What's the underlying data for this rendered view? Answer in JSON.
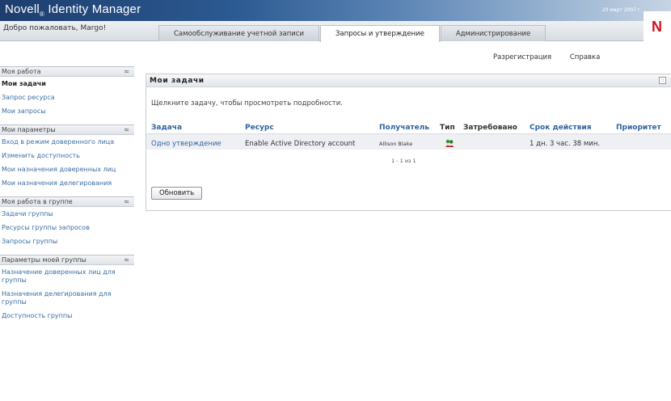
{
  "header": {
    "brand": "Novell",
    "brand_mark": "®",
    "brand_product": " Identity Manager",
    "date": "20 март 2007 г.",
    "logo_letter": "N",
    "welcome": "Добро пожаловать, Margo!"
  },
  "tabs": [
    {
      "label": "Самообслуживание учетной записи",
      "active": false
    },
    {
      "label": "Запросы и утверждение",
      "active": true
    },
    {
      "label": "Администрирование",
      "active": false
    }
  ],
  "toplinks": {
    "logout": "Разрегистрация",
    "help": "Справка"
  },
  "sidebar": {
    "sections": [
      {
        "title": "Моя работа",
        "items": [
          "Мои задачи",
          "Запрос ресурса",
          "Мои запросы"
        ]
      },
      {
        "title": "Мои параметры",
        "items": [
          "Вход в режим доверенного лица",
          "Изменить доступность",
          "Мои назначения доверенных лиц",
          "Мои назначения делегирования"
        ]
      },
      {
        "title": "Моя работа в группе",
        "items": [
          "Задачи группы",
          "Ресурсы группы запросов",
          "Запросы группы"
        ]
      },
      {
        "title": "Параметры моей группы",
        "items": [
          "Назначение доверенных лиц для группы",
          "Назначения делегирования для группы",
          "Доступность группы"
        ]
      }
    ],
    "collapse_glyph": "≈"
  },
  "panel": {
    "title": "Мои задачи",
    "hint": "Щелкните задачу, чтобы просмотреть подробности.",
    "columns": [
      "Задача",
      "Ресурс",
      "Получатель",
      "Тип",
      "Затребовано",
      "Срок действия",
      "Приоритет"
    ],
    "rows": [
      {
        "task": "Одно утверждение",
        "resource": "Enable Active Directory account",
        "recipient": "Allison Blake",
        "type_icon": "approval-people-icon",
        "requested": "",
        "expires": "1 дн. 3 час. 38 мин.",
        "priority": ""
      }
    ],
    "pager": "1 - 1 из 1",
    "refresh_label": "Обновить"
  },
  "colors": {
    "link": "#2f63a3",
    "logo_red": "#d2111b",
    "header_dark": "#1d3d6e"
  }
}
